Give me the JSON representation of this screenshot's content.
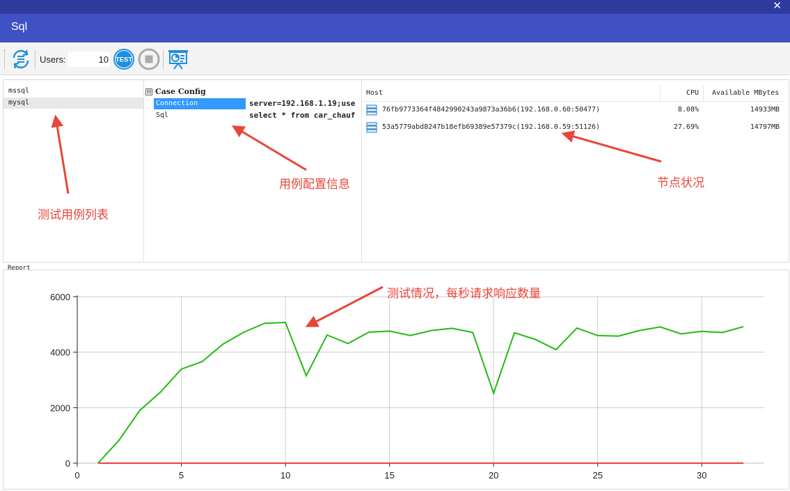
{
  "window": {
    "title": "Sql",
    "close_symbol": "✕"
  },
  "toolbar": {
    "users_label": "Users:",
    "users_value": "10",
    "test_label": "TEST"
  },
  "cases": [
    "mssql",
    "mysql"
  ],
  "config": {
    "header": "Case Config",
    "toggle": "⊟",
    "rows": [
      {
        "key": "Connection",
        "value": "server=192.168.1.19;use"
      },
      {
        "key": "Sql",
        "value": "select * from car_chauf"
      }
    ]
  },
  "nodes": {
    "columns": {
      "host": "Host",
      "cpu": "CPU",
      "memory": "Available MBytes"
    },
    "rows": [
      {
        "host": "76fb9773364f4842990243a9873a36b6(192.168.0.60:50477)",
        "cpu": "8.08%",
        "memory": "14933MB"
      },
      {
        "host": "53a5779abd8247b18efb69389e57379c(192.168.0.59:51126)",
        "cpu": "27.69%",
        "memory": "14797MB"
      }
    ]
  },
  "report": {
    "label": "Report"
  },
  "annotations": {
    "cases": "测试用例列表",
    "config": "用例配置信息",
    "nodes": "节点状况",
    "report": "测试情况，每秒请求响应数量"
  },
  "colors": {
    "title_bar": "#3f51c3",
    "title_strip": "#2e3a9e",
    "accent": "#1e8fe0",
    "annotation": "#e8463a",
    "series_green": "#22bb11",
    "series_red": "#e84040"
  },
  "chart_data": {
    "type": "line",
    "x": [
      1,
      2,
      3,
      4,
      5,
      6,
      7,
      8,
      9,
      10,
      11,
      12,
      13,
      14,
      15,
      16,
      17,
      18,
      19,
      20,
      21,
      22,
      23,
      24,
      25,
      26,
      27,
      28,
      29,
      30,
      31,
      32
    ],
    "series": [
      {
        "color": "#22bb11",
        "values": [
          0,
          820,
          1900,
          2560,
          3390,
          3660,
          4290,
          4720,
          5040,
          5070,
          3150,
          4620,
          4310,
          4720,
          4760,
          4600,
          4780,
          4860,
          4710,
          2520,
          4700,
          4460,
          4090,
          4870,
          4600,
          4580,
          4780,
          4910,
          4660,
          4750,
          4710,
          4920
        ]
      },
      {
        "color": "#e84040",
        "values": [
          0,
          0,
          0,
          0,
          0,
          0,
          0,
          0,
          0,
          0,
          0,
          0,
          0,
          0,
          0,
          0,
          0,
          0,
          0,
          0,
          0,
          0,
          0,
          0,
          0,
          0,
          0,
          0,
          0,
          0,
          0,
          0
        ]
      }
    ],
    "xlim": [
      0,
      33
    ],
    "ylim": [
      0,
      6000
    ],
    "x_ticks": [
      "0",
      "5",
      "10",
      "15",
      "20",
      "25",
      "30"
    ],
    "y_ticks": [
      "0",
      "2000",
      "4000",
      "6000"
    ],
    "grid": true
  }
}
